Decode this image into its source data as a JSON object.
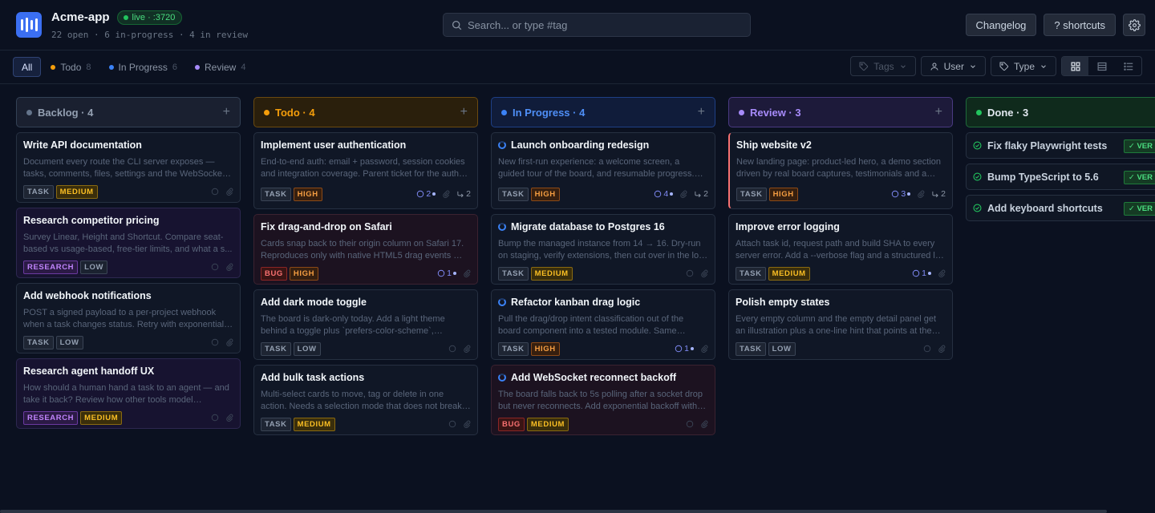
{
  "app": {
    "title": "Acme-app",
    "live_badge": "live · :3720",
    "counts": "22 open · 6 in-progress · 4 in review"
  },
  "search": {
    "placeholder": "Search... or type #tag"
  },
  "header_buttons": {
    "changelog": "Changelog",
    "shortcuts": "? shortcuts",
    "settings_icon": "gear-icon"
  },
  "filters": {
    "tabs": [
      {
        "label": "All",
        "count": ""
      },
      {
        "label": "Todo",
        "count": "8",
        "color": "#f59e0b"
      },
      {
        "label": "In Progress",
        "count": "6",
        "color": "#3b82f6"
      },
      {
        "label": "Review",
        "count": "4",
        "color": "#a78bfa"
      }
    ],
    "tags_label": "Tags",
    "user_label": "User",
    "type_label": "Type"
  },
  "columns": {
    "backlog": {
      "label": "Backlog · 4",
      "color": "#64748b"
    },
    "todo": {
      "label": "Todo · 4",
      "color": "#f59e0b"
    },
    "progress": {
      "label": "In Progress · 4",
      "color": "#3b82f6"
    },
    "review": {
      "label": "Review · 3",
      "color": "#a78bfa"
    },
    "done": {
      "label": "Done · 3",
      "color": "#22c55e"
    }
  },
  "cards": {
    "b1": {
      "title": "Write API documentation",
      "desc": "Document every route the CLI server exposes — tasks, comments, files, settings and the WebSocket events.",
      "type": "TASK",
      "priority": "MEDIUM"
    },
    "b2": {
      "title": "Research competitor pricing",
      "desc": "Survey Linear, Height and Shortcut. Compare seat-based vs usage-based, free-tier limits, and what a s...",
      "type": "RESEARCH",
      "priority": "LOW"
    },
    "b3": {
      "title": "Add webhook notifications",
      "desc": "POST a signed payload to a per-project webhook when a task changes status. Retry with exponential backoff.",
      "type": "TASK",
      "priority": "LOW"
    },
    "b4": {
      "title": "Research agent handoff UX",
      "desc": "How should a human hand a task to an agent — and take it back? Review how other tools model ownershi...",
      "type": "RESEARCH",
      "priority": "MEDIUM"
    },
    "t1": {
      "title": "Implement user authentication",
      "desc": "End-to-end auth: email + password, session cookies and integration coverage. Parent ticket for the auth work.",
      "type": "TASK",
      "priority": "HIGH",
      "comments": "2",
      "subtasks": "2"
    },
    "t2": {
      "title": "Fix drag-and-drop on Safari",
      "desc": "Cards snap back to their origin column on Safari 17. Reproduces only with native HTML5 drag events — fine elsewhere.",
      "type": "BUG",
      "priority": "HIGH",
      "comments": "1"
    },
    "t3": {
      "title": "Add dark mode toggle",
      "desc": "The board is dark-only today. Add a light theme behind a toggle plus `prefers-color-scheme`, persisted per user.",
      "type": "TASK",
      "priority": "LOW"
    },
    "t4": {
      "title": "Add bulk task actions",
      "desc": "Multi-select cards to move, tag or delete in one action. Needs a selection mode that does not break drag-and-drop.",
      "type": "TASK",
      "priority": "MEDIUM"
    },
    "p1": {
      "title": "Launch onboarding redesign",
      "desc": "New first-run experience: a welcome screen, a guided tour of the board, and resumable progress. Parent ticket.",
      "type": "TASK",
      "priority": "HIGH",
      "comments": "4",
      "subtasks": "2"
    },
    "p2": {
      "title": "Migrate database to Postgres 16",
      "desc": "Bump the managed instance from 14 → 16. Dry-run on staging, verify extensions, then cut over in the low-traffic window.",
      "type": "TASK",
      "priority": "MEDIUM"
    },
    "p3": {
      "title": "Refactor kanban drag logic",
      "desc": "Pull the drag/drop intent classification out of the board component into a tested module. Same behaviour, less code.",
      "type": "TASK",
      "priority": "HIGH",
      "comments": "1"
    },
    "p4": {
      "title": "Add WebSocket reconnect backoff",
      "desc": "The board falls back to 5s polling after a socket drop but never reconnects. Add exponential backoff with jitter.",
      "type": "BUG",
      "priority": "MEDIUM"
    },
    "r1": {
      "title": "Ship website v2",
      "desc": "New landing page: product-led hero, a demo section driven by real board captures, testimonials and a pricing page.",
      "type": "TASK",
      "priority": "HIGH",
      "comments": "3",
      "subtasks": "2"
    },
    "r2": {
      "title": "Improve error logging",
      "desc": "Attach task id, request path and build SHA to every server error. Add a --verbose flag and a structured log format.",
      "type": "TASK",
      "priority": "MEDIUM",
      "comments": "1"
    },
    "r3": {
      "title": "Polish empty states",
      "desc": "Every empty column and the empty detail panel get an illustration plus a one-line hint that points at the next action.",
      "type": "TASK",
      "priority": "LOW"
    }
  },
  "done": [
    {
      "title": "Fix flaky Playwright tests",
      "badge": "✓ VER"
    },
    {
      "title": "Bump TypeScript to 5.6",
      "badge": "✓ VER"
    },
    {
      "title": "Add keyboard shortcuts",
      "badge": "✓ VER"
    }
  ]
}
